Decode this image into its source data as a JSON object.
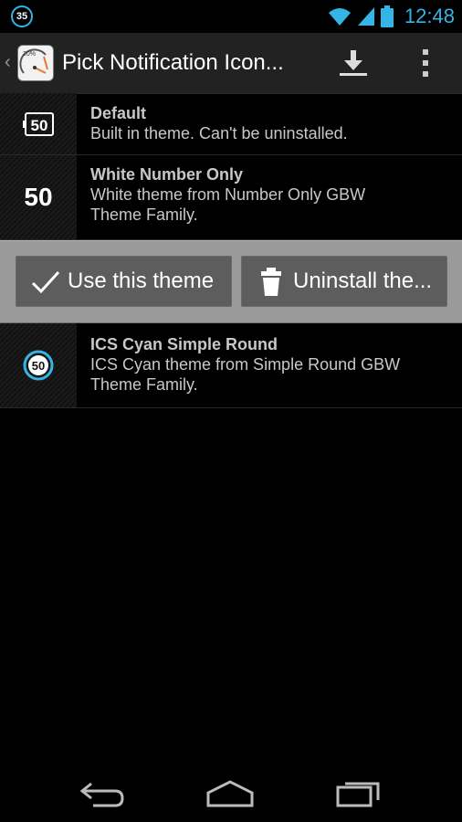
{
  "status_bar": {
    "notification_count": "35",
    "time": "12:48"
  },
  "action_bar": {
    "title": "Pick Notification Icon..."
  },
  "themes": [
    {
      "name": "Default",
      "description": "Built in theme. Can't be uninstalled.",
      "preview_number": "50"
    },
    {
      "name": "White Number Only",
      "description_lines": [
        "White theme from Number Only GBW",
        "Theme Family."
      ],
      "preview_number": "50"
    },
    {
      "name": "ICS Cyan Simple Round",
      "description_lines": [
        "ICS Cyan theme from Simple Round GBW",
        "Theme Family."
      ],
      "preview_number": "50"
    }
  ],
  "actions": {
    "use_label": "Use this theme",
    "uninstall_label": "Uninstall the..."
  },
  "colors": {
    "accent": "#33b5e5",
    "action_bar_bg": "#222222",
    "expanded_bg": "#9a9a9a",
    "button_bg": "#5d5d5d"
  },
  "icons": {
    "download": "download-icon",
    "overflow": "overflow-menu-icon",
    "check": "checkmark-icon",
    "trash": "trash-icon",
    "back": "back-icon",
    "home": "home-icon",
    "recents": "recent-apps-icon"
  }
}
